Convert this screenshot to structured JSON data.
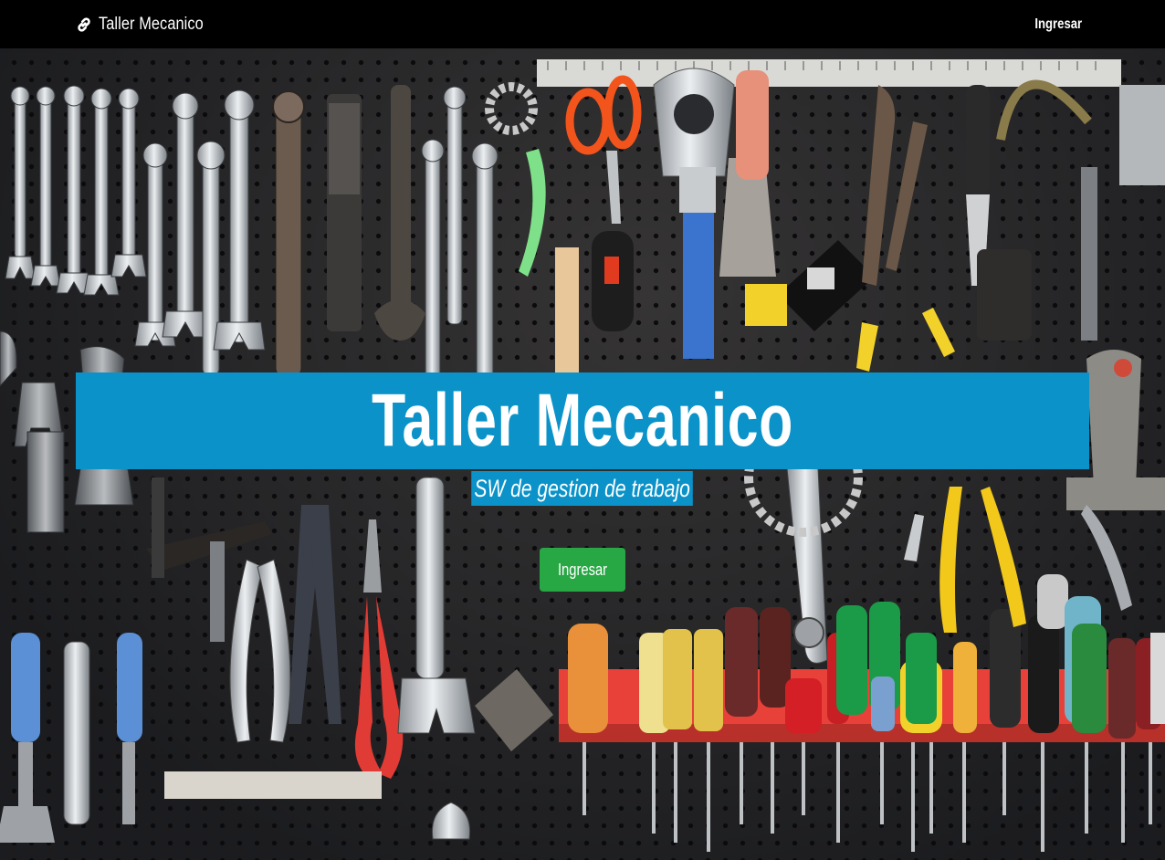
{
  "navbar": {
    "brand_label": "Taller Mecanico",
    "brand_icon": "link-icon",
    "login_label": "Ingresar"
  },
  "hero": {
    "title": "Taller Mecanico",
    "subtitle": "SW de gestion de trabajo",
    "cta_label": "Ingresar",
    "background": "pegboard-tools-photo"
  },
  "colors": {
    "navbar_bg": "#000000",
    "headline_bg": "#0b93c9",
    "cta_bg": "#28a745",
    "text": "#ffffff"
  }
}
